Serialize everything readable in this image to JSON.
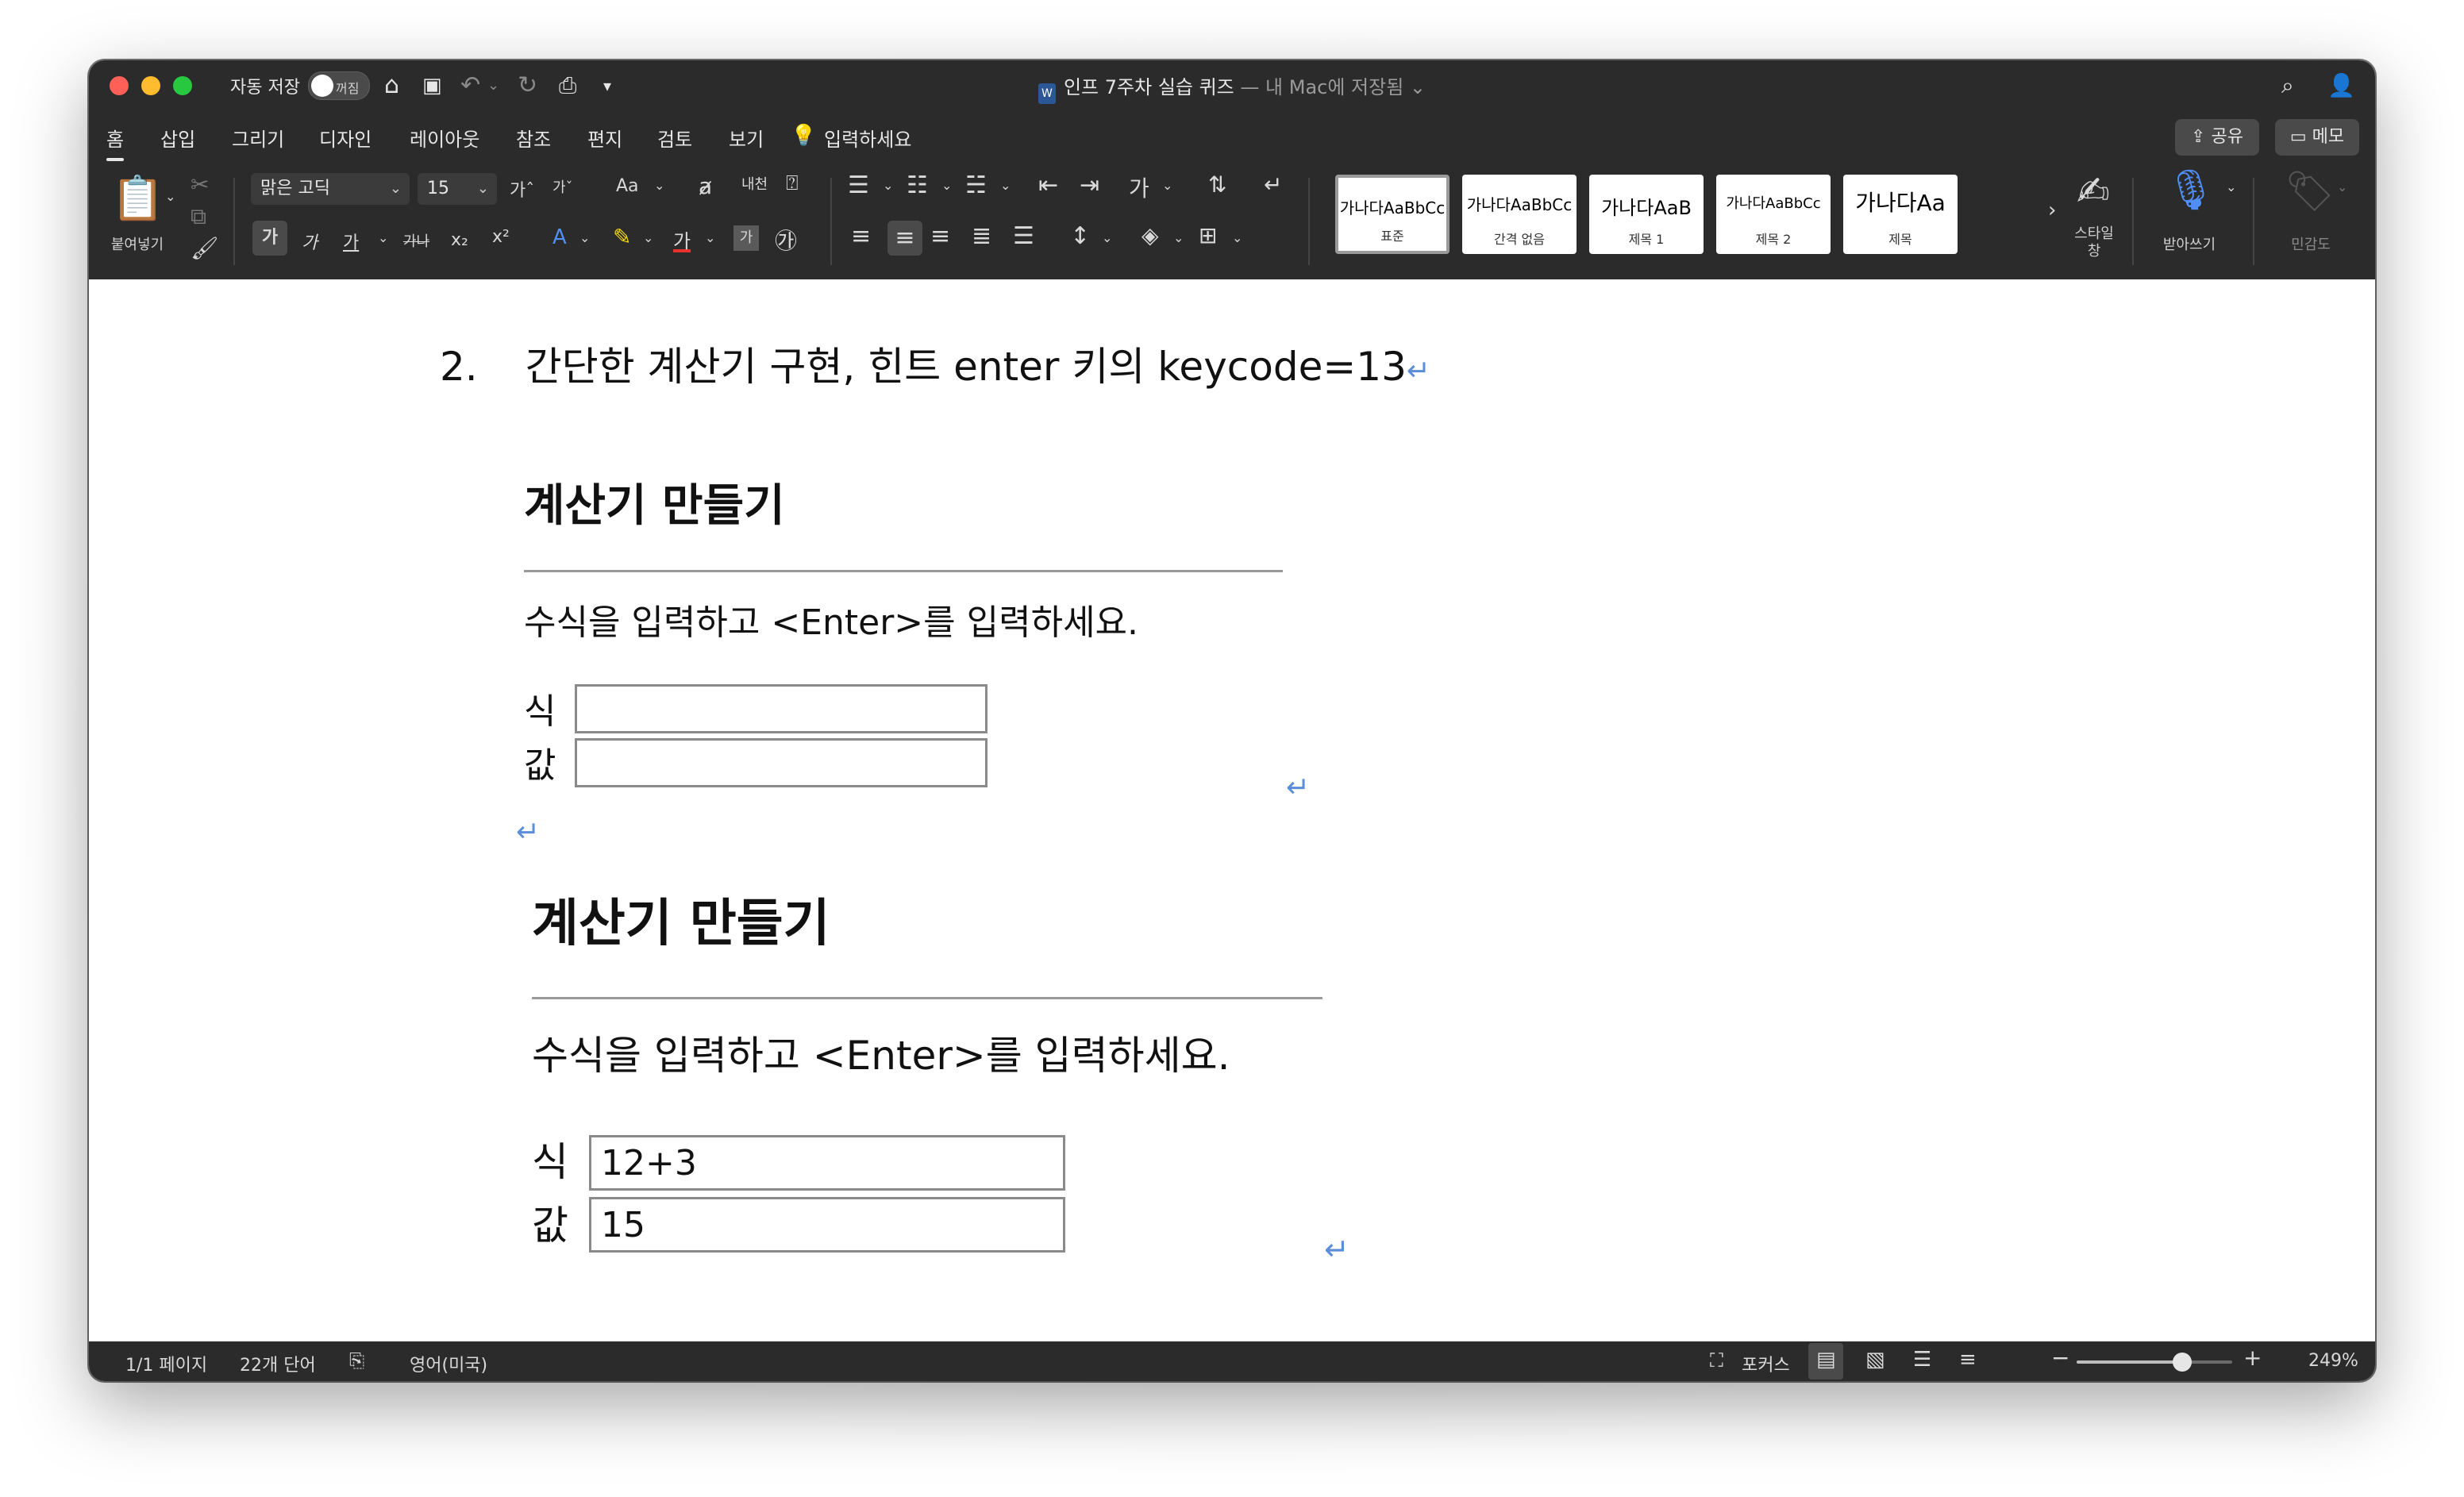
{
  "titlebar": {
    "autosave_label": "자동 저장",
    "autosave_state": "꺼짐",
    "doc_title": "인프 7주차 실습 퀴즈",
    "doc_location": " — 내 Mac에 저장됨 ⌄"
  },
  "menu": {
    "tabs": [
      "홈",
      "삽입",
      "그리기",
      "디자인",
      "레이아웃",
      "참조",
      "편지",
      "검토",
      "보기"
    ],
    "tell_me": "입력하세요",
    "share_label": "공유",
    "memo_label": "메모"
  },
  "ribbon": {
    "paste_label": "붙여넣기",
    "font_name": "맑은 고딕",
    "font_size": "15",
    "font_grow": "가ˆ",
    "font_shrink": "가ˇ",
    "change_case": "Aa",
    "bold": "가",
    "italic": "가",
    "underline": "가",
    "strikethrough": "가나",
    "subscript": "x₂",
    "superscript": "x²",
    "styles": [
      {
        "sample": "가나다AaBbCc",
        "name": "표준"
      },
      {
        "sample": "가나다AaBbCc",
        "name": "간격 없음"
      },
      {
        "sample": "가나다AaB",
        "name": "제목 1"
      },
      {
        "sample": "가나다AaBbCc",
        "name": "제목 2"
      },
      {
        "sample": "가나다Aa",
        "name": "제목"
      }
    ],
    "style_pane_label": "스타일 창",
    "dictate_label": "받아쓰기",
    "sensitivity_label": "민감도"
  },
  "document": {
    "item_number": "2.",
    "item_text": "간단한 계산기 구현, 힌트 enter 키의 keycode=13",
    "return_mark": "↵",
    "calc1": {
      "title": "계산기 만들기",
      "instruction": "수식을 입력하고 <Enter>를 입력하세요.",
      "expr_label": "식",
      "value_label": "값",
      "expr_value": "",
      "result_value": ""
    },
    "calc2": {
      "title": "계산기 만들기",
      "instruction": "수식을 입력하고 <Enter>를 입력하세요.",
      "expr_label": "식",
      "value_label": "값",
      "expr_value": "12+3",
      "result_value": "15"
    }
  },
  "statusbar": {
    "page": "1/1 페이지",
    "words": "22개 단어",
    "language": "영어(미국)",
    "focus": "포커스",
    "zoom": "249%",
    "zoom_level_fraction": 0.68
  }
}
